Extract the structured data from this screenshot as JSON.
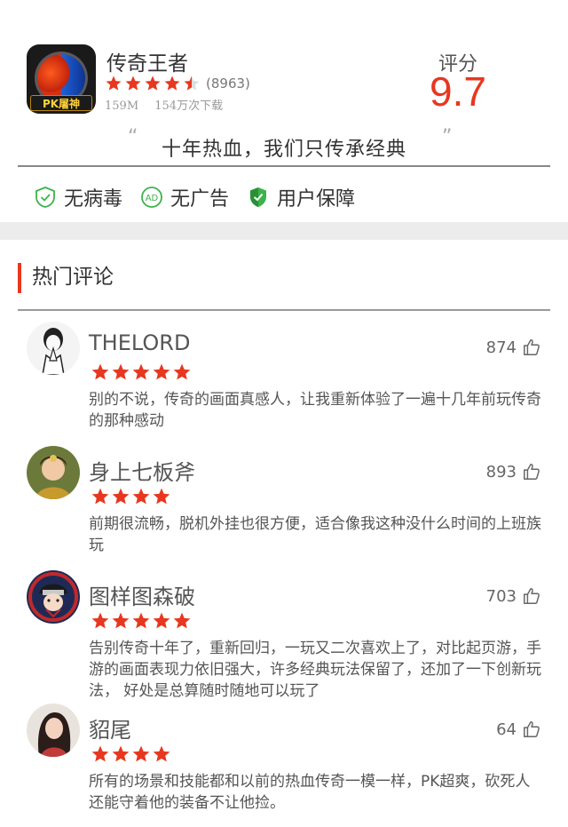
{
  "app": {
    "icon_label": "PK屠神",
    "name": "传奇王者",
    "rating_stars": 4.5,
    "rating_count": "(8963)",
    "size": "159M",
    "downloads": "154万次下载",
    "score_label": "评分",
    "score_value": "9.7"
  },
  "slogan": {
    "open_quote": "“",
    "text": "十年热血，我们只传承经典",
    "close_quote": "”"
  },
  "badges": [
    {
      "label": "无病毒",
      "icon": "shield-outline-icon"
    },
    {
      "label": "无广告",
      "icon": "ad-circle-icon"
    },
    {
      "label": "用户保障",
      "icon": "shield-check-icon"
    }
  ],
  "colors": {
    "accent": "#e8371f",
    "green": "#3bb34a"
  },
  "comments_section": {
    "title": "热门评论",
    "items": [
      {
        "name": "THELORD",
        "stars": 5,
        "likes": "874",
        "text": "别的不说，传奇的画面真感人，让我重新体验了一遍十几年前玩传奇的那种感动"
      },
      {
        "name": "身上七板斧",
        "stars": 4,
        "likes": "893",
        "text": "前期很流畅，脱机外挂也很方便，适合像我这种没什么时间的上班族玩"
      },
      {
        "name": "图样图森破",
        "stars": 5,
        "likes": "703",
        "text": "告别传奇十年了，重新回归，一玩又二次喜欢上了，对比起页游，手游的画面表现力依旧强大，许多经典玩法保留了，还加了一下创新玩法， 好处是总算随时随地可以玩了"
      },
      {
        "name": "貂尾",
        "stars": 4,
        "likes": "64",
        "text": "所有的场景和技能都和以前的热血传奇一模一样，PK超爽，砍死人还能守着他的装备不让他捡。"
      }
    ]
  }
}
